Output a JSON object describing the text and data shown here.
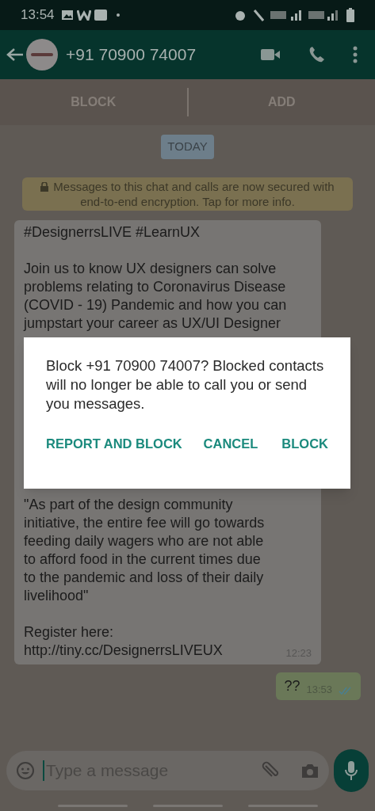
{
  "status_bar": {
    "time": "13:54"
  },
  "header": {
    "title": "+91 70900 74007"
  },
  "action_bar": {
    "buttons": [
      "BLOCK",
      "ADD"
    ]
  },
  "date_chip": "TODAY",
  "encryption_notice": "Messages to this chat and calls are now secured with end-to-end encryption. Tap for more info.",
  "incoming_message": {
    "hashtags": "#DesignerrsLIVE #LearnUX",
    "paragraph_top": "Join us to know UX designers can solve\nproblems relating to Coronavirus Disease\n(COVID - 19) Pandemic and how you can\njumpstart your career as UX/UI Designer",
    "paragraph_bottom": "\"As part of the design community\ninitiative, the entire fee will go towards\nfeeding daily wagers who are not able\nto afford food in the current times due\nto the pandemic and loss of their daily\nlivelihood\"",
    "register_label": "Register here:",
    "link": "http://tiny.cc/DesignerrsLIVEUX",
    "time": "12:23"
  },
  "outgoing_message": {
    "text": "??",
    "time": "13:53",
    "read": true
  },
  "composer": {
    "placeholder": "Type a message"
  },
  "dialog": {
    "text": "Block +91 70900 74007? Blocked contacts will no longer be able to call you or send you messages.",
    "buttons": [
      "REPORT AND BLOCK",
      "CANCEL",
      "BLOCK"
    ]
  }
}
